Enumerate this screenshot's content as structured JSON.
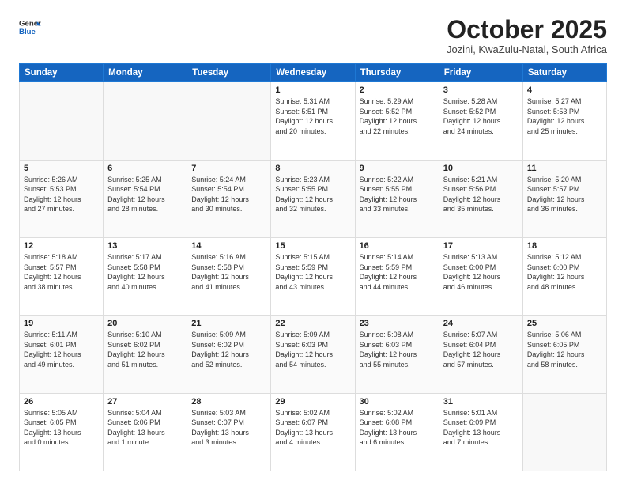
{
  "header": {
    "logo_line1": "General",
    "logo_line2": "Blue",
    "title": "October 2025",
    "subtitle": "Jozini, KwaZulu-Natal, South Africa"
  },
  "weekdays": [
    "Sunday",
    "Monday",
    "Tuesday",
    "Wednesday",
    "Thursday",
    "Friday",
    "Saturday"
  ],
  "weeks": [
    [
      {
        "day": "",
        "info": ""
      },
      {
        "day": "",
        "info": ""
      },
      {
        "day": "",
        "info": ""
      },
      {
        "day": "1",
        "info": "Sunrise: 5:31 AM\nSunset: 5:51 PM\nDaylight: 12 hours\nand 20 minutes."
      },
      {
        "day": "2",
        "info": "Sunrise: 5:29 AM\nSunset: 5:52 PM\nDaylight: 12 hours\nand 22 minutes."
      },
      {
        "day": "3",
        "info": "Sunrise: 5:28 AM\nSunset: 5:52 PM\nDaylight: 12 hours\nand 24 minutes."
      },
      {
        "day": "4",
        "info": "Sunrise: 5:27 AM\nSunset: 5:53 PM\nDaylight: 12 hours\nand 25 minutes."
      }
    ],
    [
      {
        "day": "5",
        "info": "Sunrise: 5:26 AM\nSunset: 5:53 PM\nDaylight: 12 hours\nand 27 minutes."
      },
      {
        "day": "6",
        "info": "Sunrise: 5:25 AM\nSunset: 5:54 PM\nDaylight: 12 hours\nand 28 minutes."
      },
      {
        "day": "7",
        "info": "Sunrise: 5:24 AM\nSunset: 5:54 PM\nDaylight: 12 hours\nand 30 minutes."
      },
      {
        "day": "8",
        "info": "Sunrise: 5:23 AM\nSunset: 5:55 PM\nDaylight: 12 hours\nand 32 minutes."
      },
      {
        "day": "9",
        "info": "Sunrise: 5:22 AM\nSunset: 5:55 PM\nDaylight: 12 hours\nand 33 minutes."
      },
      {
        "day": "10",
        "info": "Sunrise: 5:21 AM\nSunset: 5:56 PM\nDaylight: 12 hours\nand 35 minutes."
      },
      {
        "day": "11",
        "info": "Sunrise: 5:20 AM\nSunset: 5:57 PM\nDaylight: 12 hours\nand 36 minutes."
      }
    ],
    [
      {
        "day": "12",
        "info": "Sunrise: 5:18 AM\nSunset: 5:57 PM\nDaylight: 12 hours\nand 38 minutes."
      },
      {
        "day": "13",
        "info": "Sunrise: 5:17 AM\nSunset: 5:58 PM\nDaylight: 12 hours\nand 40 minutes."
      },
      {
        "day": "14",
        "info": "Sunrise: 5:16 AM\nSunset: 5:58 PM\nDaylight: 12 hours\nand 41 minutes."
      },
      {
        "day": "15",
        "info": "Sunrise: 5:15 AM\nSunset: 5:59 PM\nDaylight: 12 hours\nand 43 minutes."
      },
      {
        "day": "16",
        "info": "Sunrise: 5:14 AM\nSunset: 5:59 PM\nDaylight: 12 hours\nand 44 minutes."
      },
      {
        "day": "17",
        "info": "Sunrise: 5:13 AM\nSunset: 6:00 PM\nDaylight: 12 hours\nand 46 minutes."
      },
      {
        "day": "18",
        "info": "Sunrise: 5:12 AM\nSunset: 6:00 PM\nDaylight: 12 hours\nand 48 minutes."
      }
    ],
    [
      {
        "day": "19",
        "info": "Sunrise: 5:11 AM\nSunset: 6:01 PM\nDaylight: 12 hours\nand 49 minutes."
      },
      {
        "day": "20",
        "info": "Sunrise: 5:10 AM\nSunset: 6:02 PM\nDaylight: 12 hours\nand 51 minutes."
      },
      {
        "day": "21",
        "info": "Sunrise: 5:09 AM\nSunset: 6:02 PM\nDaylight: 12 hours\nand 52 minutes."
      },
      {
        "day": "22",
        "info": "Sunrise: 5:09 AM\nSunset: 6:03 PM\nDaylight: 12 hours\nand 54 minutes."
      },
      {
        "day": "23",
        "info": "Sunrise: 5:08 AM\nSunset: 6:03 PM\nDaylight: 12 hours\nand 55 minutes."
      },
      {
        "day": "24",
        "info": "Sunrise: 5:07 AM\nSunset: 6:04 PM\nDaylight: 12 hours\nand 57 minutes."
      },
      {
        "day": "25",
        "info": "Sunrise: 5:06 AM\nSunset: 6:05 PM\nDaylight: 12 hours\nand 58 minutes."
      }
    ],
    [
      {
        "day": "26",
        "info": "Sunrise: 5:05 AM\nSunset: 6:05 PM\nDaylight: 13 hours\nand 0 minutes."
      },
      {
        "day": "27",
        "info": "Sunrise: 5:04 AM\nSunset: 6:06 PM\nDaylight: 13 hours\nand 1 minute."
      },
      {
        "day": "28",
        "info": "Sunrise: 5:03 AM\nSunset: 6:07 PM\nDaylight: 13 hours\nand 3 minutes."
      },
      {
        "day": "29",
        "info": "Sunrise: 5:02 AM\nSunset: 6:07 PM\nDaylight: 13 hours\nand 4 minutes."
      },
      {
        "day": "30",
        "info": "Sunrise: 5:02 AM\nSunset: 6:08 PM\nDaylight: 13 hours\nand 6 minutes."
      },
      {
        "day": "31",
        "info": "Sunrise: 5:01 AM\nSunset: 6:09 PM\nDaylight: 13 hours\nand 7 minutes."
      },
      {
        "day": "",
        "info": ""
      }
    ]
  ]
}
